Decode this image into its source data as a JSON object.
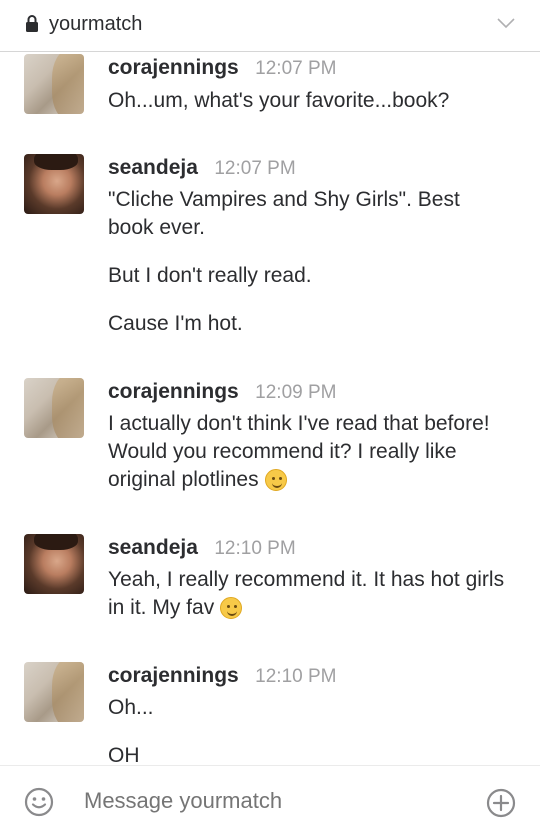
{
  "header": {
    "channel": "yourmatch",
    "lock_icon": "lock-icon",
    "chevron_icon": "chevron-down-icon"
  },
  "messages": [
    {
      "user": "corajennings",
      "time": "12:07 PM",
      "avatar": "cora",
      "lines": [
        "Oh...um, what's your favorite...book?"
      ]
    },
    {
      "user": "seandeja",
      "time": "12:07 PM",
      "avatar": "sean",
      "lines": [
        "\"Cliche Vampires and Shy Girls\". Best book ever.",
        "But I don't really read.",
        "Cause I'm hot."
      ]
    },
    {
      "user": "corajennings",
      "time": "12:09 PM",
      "avatar": "cora",
      "lines": [
        "I actually don't think I've read that before! Would you recommend it? I really like original plotlines"
      ],
      "emoji": "slightly-smiling-face-icon"
    },
    {
      "user": "seandeja",
      "time": "12:10 PM",
      "avatar": "sean",
      "lines": [
        "Yeah, I really recommend it. It has hot girls in it. My fav"
      ],
      "emoji": "winking-face-icon"
    },
    {
      "user": "corajennings",
      "time": "12:10 PM",
      "avatar": "cora",
      "lines": [
        "Oh...",
        "OH"
      ]
    }
  ],
  "composer": {
    "placeholder": "Message yourmatch",
    "emoji_icon": "smiley-icon",
    "add_icon": "plus-circle-icon"
  },
  "colors": {
    "text": "#2c2d30",
    "muted": "#a0a0a2",
    "divider": "#d6d6d6"
  }
}
